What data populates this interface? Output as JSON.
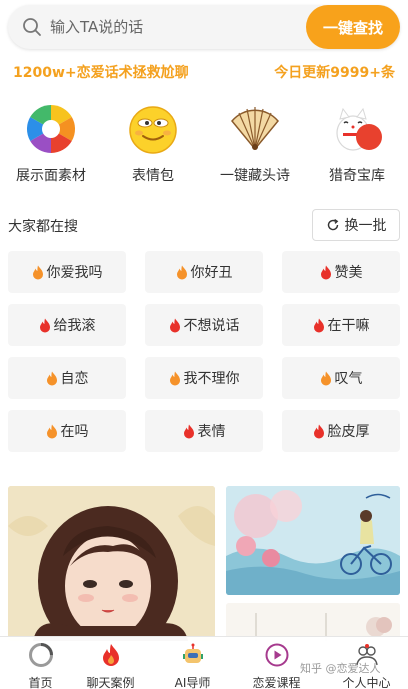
{
  "search": {
    "placeholder": "输入TA说的话",
    "button_label": "一键查找"
  },
  "promo": {
    "left_text": "1200w+恋爱话术拯救尬聊",
    "right_text": "今日更新9999+条"
  },
  "features": [
    {
      "label": "展示面素材",
      "icon": "aperture-icon"
    },
    {
      "label": "表情包",
      "icon": "emoji-icon"
    },
    {
      "label": "一键藏头诗",
      "icon": "folding-fan-icon"
    },
    {
      "label": "猎奇宝库",
      "icon": "lucky-cat-icon"
    }
  ],
  "hot": {
    "title": "大家都在搜",
    "refresh_label": "换一批",
    "tags": [
      {
        "label": "你爱我吗",
        "flame": "orange"
      },
      {
        "label": "你好丑",
        "flame": "orange"
      },
      {
        "label": "赞美",
        "flame": "red"
      },
      {
        "label": "给我滚",
        "flame": "red"
      },
      {
        "label": "不想说话",
        "flame": "red"
      },
      {
        "label": "在干嘛",
        "flame": "red"
      },
      {
        "label": "自恋",
        "flame": "orange"
      },
      {
        "label": "我不理你",
        "flame": "orange"
      },
      {
        "label": "叹气",
        "flame": "orange"
      },
      {
        "label": "在吗",
        "flame": "orange"
      },
      {
        "label": "表情",
        "flame": "red"
      },
      {
        "label": "脸皮厚",
        "flame": "red"
      }
    ]
  },
  "tabbar": [
    {
      "label": "首页",
      "icon": "home-ring-icon"
    },
    {
      "label": "聊天案例",
      "icon": "flame-icon"
    },
    {
      "label": "AI导师",
      "icon": "robot-icon"
    },
    {
      "label": "恋爱课程",
      "icon": "play-circle-icon"
    },
    {
      "label": "个人中心",
      "icon": "person-icon"
    }
  ],
  "watermark": "知乎 @恋爱达人",
  "colors": {
    "accent": "#f8a21b",
    "promo": "#f4a11f",
    "flame_red": "#e8312a",
    "flame_orange": "#f5922a"
  }
}
